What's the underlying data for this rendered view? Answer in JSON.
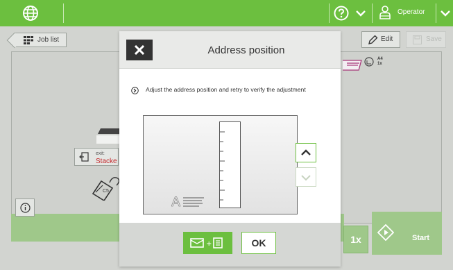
{
  "topbar": {
    "user_label": "Operator",
    "accent_color": "#6cbf3f",
    "icons": [
      "globe-icon",
      "help-icon",
      "chevron-down-icon",
      "user-icon",
      "chevron-down-icon"
    ]
  },
  "background": {
    "job_list_label": "Job list",
    "edit_label": "Edit",
    "save_label": "Save",
    "exit_label": "exit:",
    "exit_value": "Stacke",
    "c5_label": "C5",
    "counter_label": "1x",
    "start_label": "Start",
    "badge_text_top": "A4",
    "badge_text_bottom": "1x"
  },
  "modal": {
    "title": "Address position",
    "instruction": "Adjust the address position and retry to verify the adjustment",
    "ok_label": "OK",
    "address_glyph": "A"
  }
}
